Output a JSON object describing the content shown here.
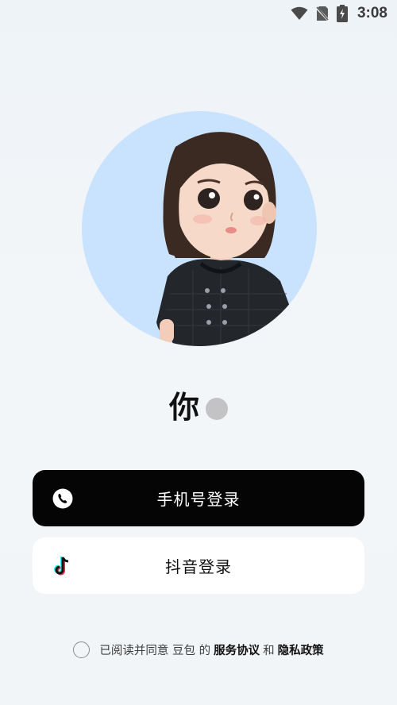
{
  "status_bar": {
    "time": "3:08",
    "icons": [
      "wifi-icon",
      "no-sim-icon",
      "battery-charging-icon"
    ]
  },
  "avatar": {
    "icon": "avatar-girl-character",
    "background_color": "#c9e2fd"
  },
  "greeting": {
    "text": "你"
  },
  "login_buttons": {
    "phone": {
      "label": "手机号登录",
      "icon": "phone-icon"
    },
    "douyin": {
      "label": "抖音登录",
      "icon": "douyin-logo-icon"
    }
  },
  "agreement": {
    "prefix": "已阅读并同意 豆包 的",
    "terms_link": "服务协议",
    "conjunction": "和",
    "privacy_link": "隐私政策"
  },
  "colors": {
    "primary_button": "#050505",
    "secondary_button": "#ffffff",
    "typing_dot": "#c3c3c6"
  }
}
